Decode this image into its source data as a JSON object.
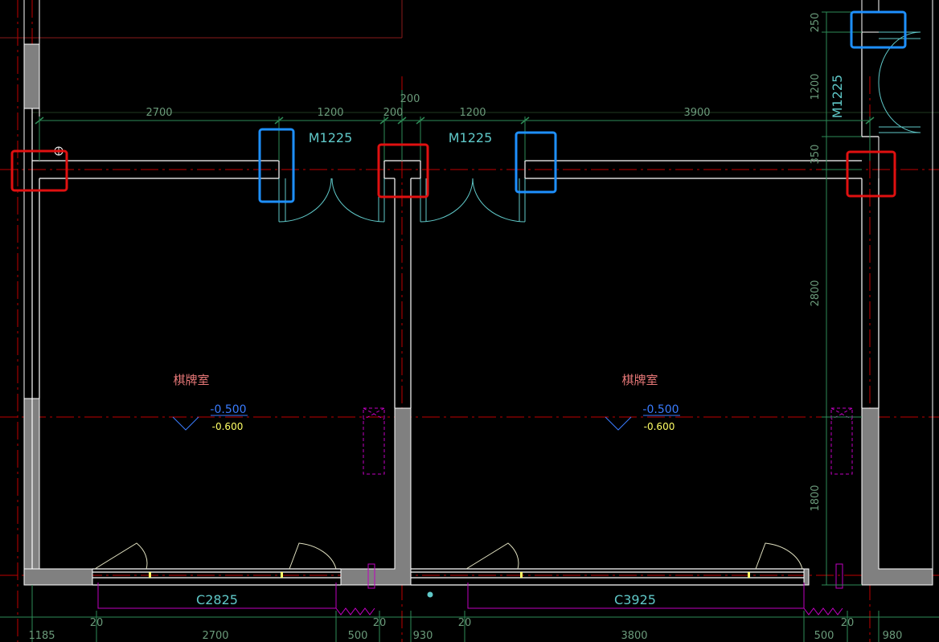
{
  "colors": {
    "background": "#000000",
    "wall": "#ffffff",
    "wall_fill": "#808080",
    "axis": "#c00000",
    "dimension": "#2e8b57",
    "dimension_text": "#6a9a7a",
    "door": "#5fc8c8",
    "room_label": "#e87878",
    "elevation_blue": "#3a7cff",
    "elevation_yellow": "#ffff66",
    "magenta": "#c000c0",
    "highlight_red": "#e01010",
    "highlight_blue": "#1e90ff"
  },
  "dimensions": {
    "top": [
      "2700",
      "1200",
      "200",
      "200",
      "1200",
      "3900"
    ],
    "right": [
      "250",
      "1200",
      "350",
      "2800",
      "1800"
    ],
    "bottom": [
      "1185",
      "20",
      "2700",
      "500",
      "20",
      "930",
      "20",
      "3800",
      "500",
      "20",
      "980"
    ]
  },
  "door_labels": [
    "M1225",
    "M1225",
    "M1225"
  ],
  "window_labels": [
    "C2825",
    "C3925"
  ],
  "rooms": [
    {
      "name": "棋牌室",
      "level_blue": "-0.500",
      "level_yellow": "-0.600"
    },
    {
      "name": "棋牌室",
      "level_blue": "-0.500",
      "level_yellow": "-0.600"
    }
  ],
  "highlights": {
    "red": [
      "left-junction",
      "middle-junction",
      "right-junction"
    ],
    "blue": [
      "door1-left-jamb",
      "door2-right-jamb",
      "top-right-jamb"
    ]
  }
}
